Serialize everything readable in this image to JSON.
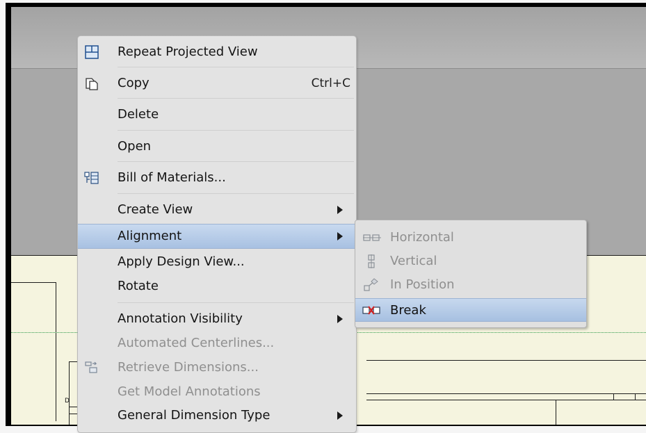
{
  "context_menu": {
    "items": [
      {
        "label": "Repeat Projected View",
        "icon": "projected-view-icon"
      },
      {
        "label": "Copy",
        "shortcut": "Ctrl+C",
        "icon": "copy-icon"
      },
      {
        "label": "Delete"
      },
      {
        "label": "Open"
      },
      {
        "label": "Bill of Materials...",
        "icon": "bill-of-materials-icon"
      },
      {
        "label": "Create View"
      },
      {
        "label": "Alignment"
      },
      {
        "label": "Apply Design View..."
      },
      {
        "label": "Rotate"
      },
      {
        "label": "Annotation Visibility"
      },
      {
        "label": "Automated Centerlines..."
      },
      {
        "label": "Retrieve Dimensions...",
        "icon": "retrieve-dimensions-icon"
      },
      {
        "label": "Get Model Annotations"
      },
      {
        "label": "General Dimension Type"
      }
    ]
  },
  "alignment_submenu": {
    "items": [
      {
        "label": "Horizontal",
        "icon": "horizontal-align-icon",
        "enabled": false
      },
      {
        "label": "Vertical",
        "icon": "vertical-align-icon",
        "enabled": false
      },
      {
        "label": "In Position",
        "icon": "in-position-icon",
        "enabled": false
      },
      {
        "label": "Break",
        "icon": "break-alignment-icon",
        "enabled": true
      }
    ]
  },
  "drawing": {
    "zone_label": "D"
  },
  "colors": {
    "highlight": "#a8c1e2",
    "sheet": "#f5f4df",
    "centerline": "#2e9a4a"
  }
}
